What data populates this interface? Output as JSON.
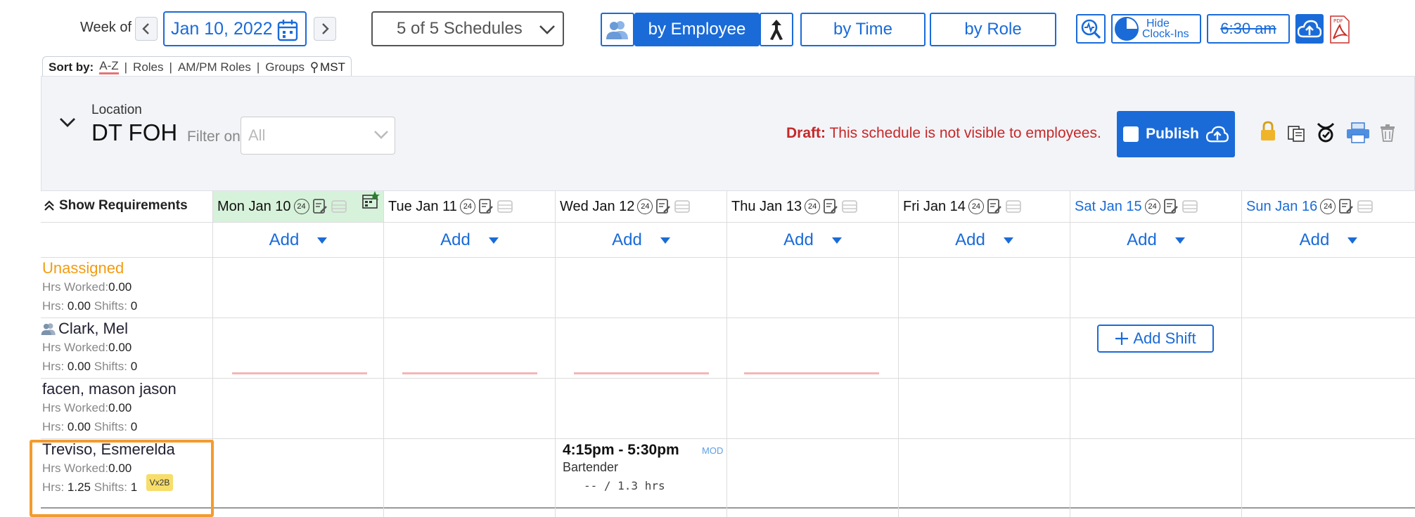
{
  "toolbar": {
    "week_label": "Week of",
    "date": "Jan 10, 2022",
    "schedules": "5 of 5 Schedules",
    "view_by_employee": "by Employee",
    "view_by_time": "by Time",
    "view_by_role": "by Role",
    "hide_clockins_line1": "Hide",
    "hide_clockins_line2": "Clock-Ins",
    "time_filter": "6:30 am",
    "pdf_label": "PDF"
  },
  "sort": {
    "label": "Sort by:",
    "options": [
      "A-Z",
      "Roles",
      "AM/PM Roles",
      "Groups"
    ],
    "timezone": "MST"
  },
  "location": {
    "sub_label": "Location",
    "name": "DT FOH",
    "filter_label": "Filter on",
    "filter_value": "All",
    "draft_prefix": "Draft:",
    "draft_message": "This schedule is not visible to employees.",
    "publish_label": "Publish"
  },
  "grid": {
    "show_requirements": "Show Requirements",
    "add_label": "Add",
    "badge": "24",
    "days": [
      {
        "label": "Mon Jan 10"
      },
      {
        "label": "Tue Jan 11"
      },
      {
        "label": "Wed Jan 12"
      },
      {
        "label": "Thu Jan 13"
      },
      {
        "label": "Fri Jan 14"
      },
      {
        "label": "Sat Jan 15"
      },
      {
        "label": "Sun Jan 16"
      }
    ],
    "hrs_worked_label": "Hrs Worked:",
    "hrs_label": "Hrs:",
    "shifts_label": "Shifts:",
    "employees": [
      {
        "name": "Unassigned",
        "hrs_worked": "0.00",
        "hrs": "0.00",
        "shifts": "0"
      },
      {
        "name": "Clark, Mel",
        "hrs_worked": "0.00",
        "hrs": "0.00",
        "shifts": "0"
      },
      {
        "name": "facen, mason jason",
        "hrs_worked": "0.00",
        "hrs": "0.00",
        "shifts": "0"
      },
      {
        "name": "Treviso, Esmerelda",
        "hrs_worked": "0.00",
        "hrs": "1.25",
        "shifts": "1",
        "tag": "Vx2B"
      }
    ],
    "add_shift_label": "Add Shift",
    "shift": {
      "time": "4:15pm - 5:30pm",
      "role": "Bartender",
      "hours": "-- / 1.3 hrs",
      "tag": "MOD"
    }
  },
  "colors": {
    "accent": "#1a6bd8",
    "draft": "#c62828",
    "unassigned": "#f39c12",
    "highlight": "#f39b2f"
  }
}
